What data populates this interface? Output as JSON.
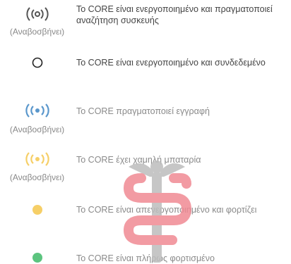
{
  "rows": [
    {
      "icon": "broadcast-waves-icon",
      "color": "#555555",
      "sublabel": "(Αναβοσβήνει)",
      "text": "Το CORE είναι ενεργοποιημένο και πραγματοποιεί αναζήτηση συσκευής"
    },
    {
      "icon": "hollow-circle-icon",
      "color": "#222222",
      "text": "Το CORE είναι ενεργοποιημένο και συνδεδεμένο"
    },
    {
      "icon": "broadcast-waves-icon",
      "color": "#5a97cc",
      "sublabel": "(Αναβοσβήνει)",
      "text": "Το CORE πραγματοποιεί εγγραφή"
    },
    {
      "icon": "broadcast-waves-icon",
      "color": "#f6cf67",
      "sublabel": "(Αναβοσβήνει)",
      "text": "Το CORE έχει χαμηλή μπαταρία"
    },
    {
      "icon": "filled-circle-icon",
      "color": "#f6cf67",
      "text": "Το CORE είναι απενεργοποιημένο και φορτίζει"
    },
    {
      "icon": "filled-circle-icon",
      "color": "#5cc47f",
      "text": "Το CORE είναι πλήρως φορτισμένο"
    }
  ],
  "watermark": {
    "icon": "caduceus-watermark-icon",
    "colors": [
      "#bdbdbd",
      "#f08a94"
    ]
  }
}
